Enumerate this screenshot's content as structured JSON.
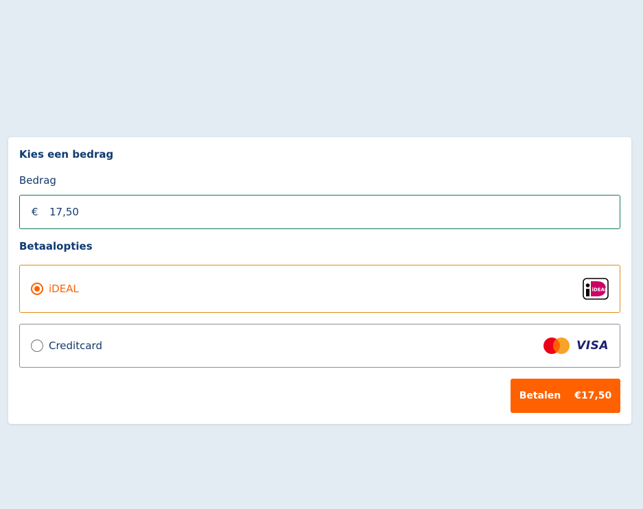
{
  "amount_section": {
    "title": "Kies een bedrag",
    "label": "Bedrag",
    "currency_symbol": "€",
    "value": "17,50"
  },
  "payment_section": {
    "title": "Betaalopties",
    "options": [
      {
        "label": "iDEAL",
        "selected": true,
        "icon": "ideal-logo-icon"
      },
      {
        "label": "Creditcard",
        "selected": false,
        "icon": "mastercard-visa-logo-icon",
        "brand_text": "VISA"
      }
    ]
  },
  "pay_button": {
    "label": "Betalen",
    "amount": "€17,50"
  },
  "colors": {
    "background": "#e3ebf3",
    "accent": "#ff6100",
    "heading": "#0e3a72",
    "ideal_pink": "#cc0066",
    "field_border": "#0f7a5a"
  }
}
